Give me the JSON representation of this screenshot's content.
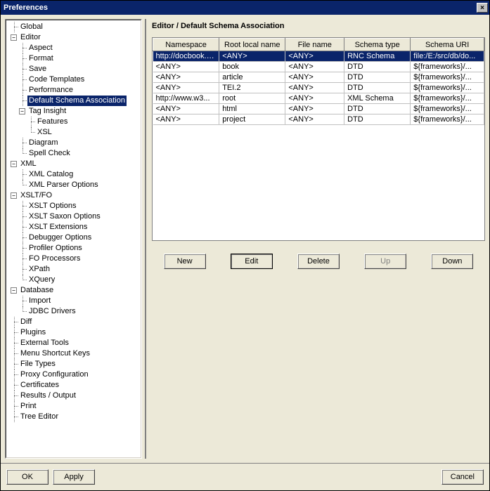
{
  "window": {
    "title": "Preferences"
  },
  "tree": {
    "global": "Global",
    "editor": "Editor",
    "editor_children": {
      "aspect": "Aspect",
      "format": "Format",
      "save": "Save",
      "code_templates": "Code Templates",
      "performance": "Performance",
      "default_schema": "Default Schema Association",
      "tag_insight": "Tag Insight",
      "features": "Features",
      "xsl": "XSL",
      "diagram": "Diagram",
      "spell_check": "Spell Check"
    },
    "xml": "XML",
    "xml_children": {
      "xml_catalog": "XML Catalog",
      "xml_parser": "XML Parser Options"
    },
    "xsltfo": "XSLT/FO",
    "xsltfo_children": {
      "xslt_options": "XSLT Options",
      "xslt_saxon": "XSLT Saxon Options",
      "xslt_ext": "XSLT Extensions",
      "debugger": "Debugger Options",
      "profiler": "Profiler Options",
      "fo_proc": "FO Processors",
      "xpath": "XPath",
      "xquery": "XQuery"
    },
    "database": "Database",
    "db_children": {
      "import": "Import",
      "jdbc": "JDBC Drivers"
    },
    "diff": "Diff",
    "plugins": "Plugins",
    "external_tools": "External Tools",
    "menu_shortcut": "Menu Shortcut Keys",
    "file_types": "File Types",
    "proxy": "Proxy Configuration",
    "certificates": "Certificates",
    "results": "Results / Output",
    "print": "Print",
    "tree_editor": "Tree Editor"
  },
  "panel": {
    "title": "Editor / Default Schema Association",
    "columns": {
      "namespace": "Namespace",
      "root": "Root local name",
      "filename": "File name",
      "schema_type": "Schema type",
      "schema_uri": "Schema URI"
    },
    "rows": [
      {
        "ns": "http://docbook.o...",
        "root": "<ANY>",
        "file": "<ANY>",
        "type": "RNC Schema",
        "uri": "file:/E:/src/db/do..."
      },
      {
        "ns": "<ANY>",
        "root": "book",
        "file": "<ANY>",
        "type": "DTD",
        "uri": "${frameworks}/..."
      },
      {
        "ns": "<ANY>",
        "root": "article",
        "file": "<ANY>",
        "type": "DTD",
        "uri": "${frameworks}/..."
      },
      {
        "ns": "<ANY>",
        "root": "TEI.2",
        "file": "<ANY>",
        "type": "DTD",
        "uri": "${frameworks}/..."
      },
      {
        "ns": "http://www.w3...",
        "root": "root",
        "file": "<ANY>",
        "type": "XML Schema",
        "uri": "${frameworks}/..."
      },
      {
        "ns": "<ANY>",
        "root": "html",
        "file": "<ANY>",
        "type": "DTD",
        "uri": "${frameworks}/..."
      },
      {
        "ns": "<ANY>",
        "root": "project",
        "file": "<ANY>",
        "type": "DTD",
        "uri": "${frameworks}/..."
      }
    ],
    "buttons": {
      "new": "New",
      "edit": "Edit",
      "delete": "Delete",
      "up": "Up",
      "down": "Down"
    }
  },
  "footer": {
    "ok": "OK",
    "apply": "Apply",
    "cancel": "Cancel"
  }
}
